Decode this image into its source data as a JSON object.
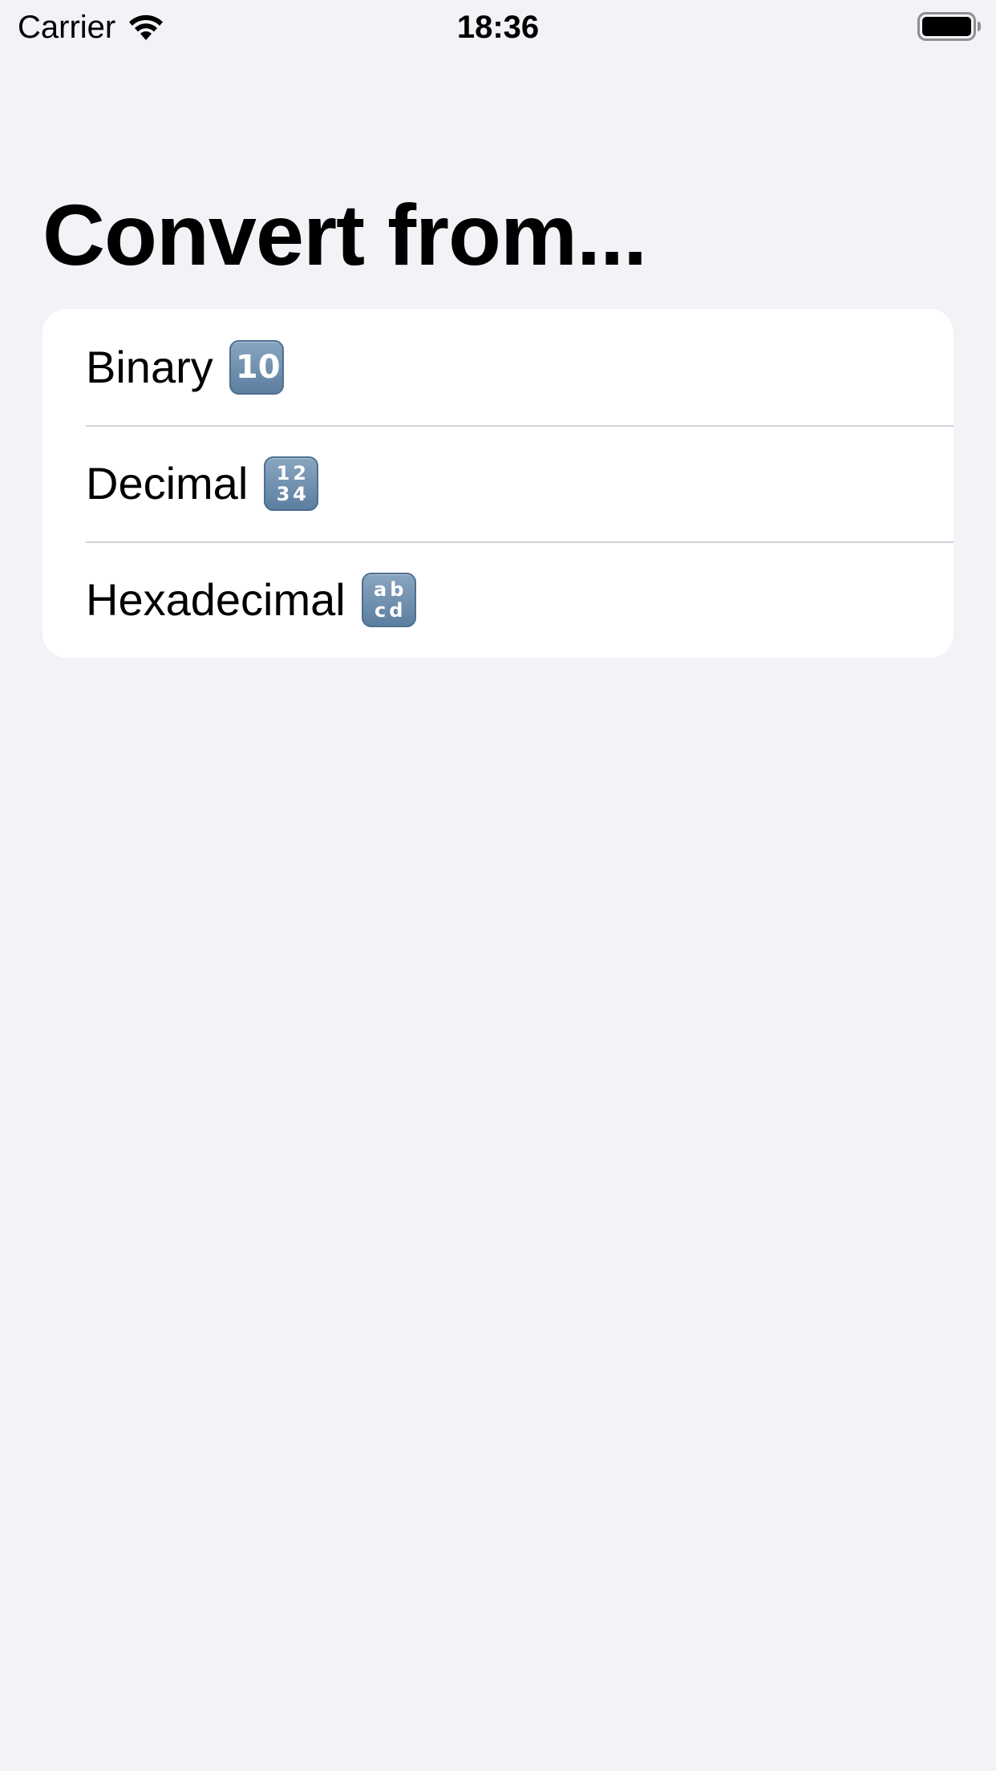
{
  "status_bar": {
    "carrier": "Carrier",
    "time": "18:36",
    "wifi_icon": "wifi-icon",
    "battery_icon": "battery-full-icon"
  },
  "title": "Convert from...",
  "items": [
    {
      "label": "Binary",
      "icon": "keycap-ten-icon",
      "keycap_lines": [
        "10"
      ]
    },
    {
      "label": "Decimal",
      "icon": "input-numbers-icon",
      "keycap_lines": [
        "12",
        "34"
      ]
    },
    {
      "label": "Hexadecimal",
      "icon": "input-latin-lowercase-icon",
      "keycap_lines": [
        "ab",
        "cd"
      ]
    }
  ],
  "colors": {
    "background": "#f2f2f7",
    "card": "#ffffff",
    "separator": "#d1d1d6",
    "keycap": "#6e8fb0"
  }
}
